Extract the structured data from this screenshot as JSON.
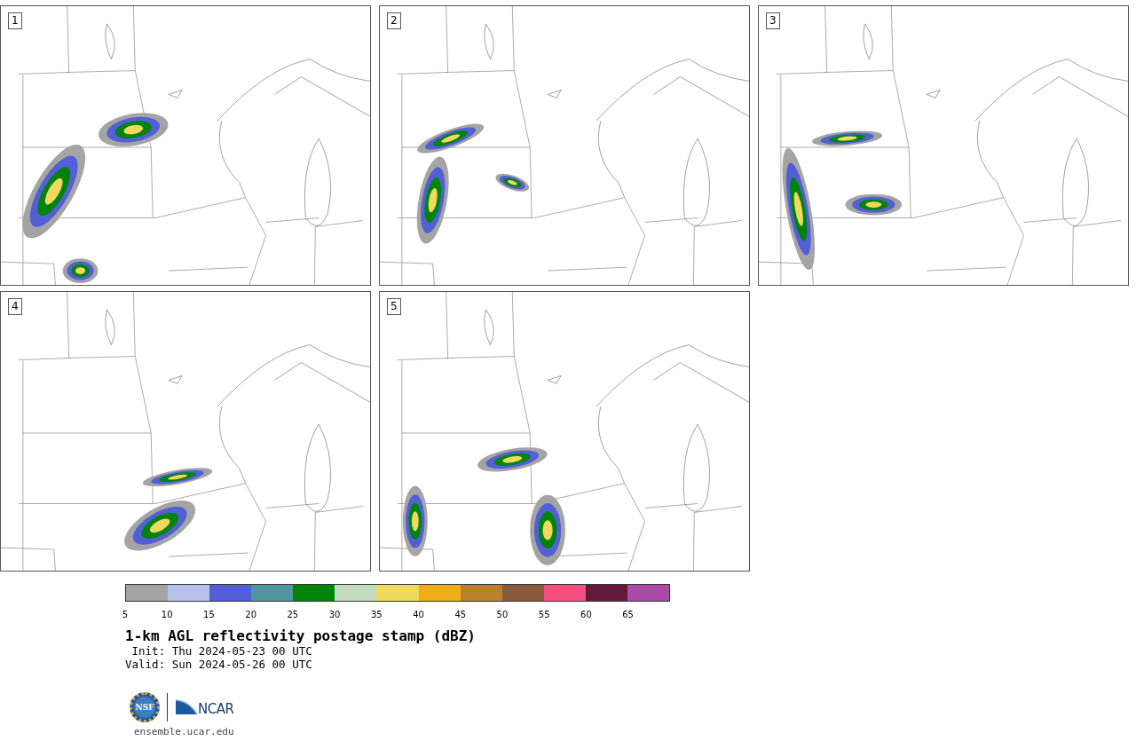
{
  "panels": [
    {
      "label": "1"
    },
    {
      "label": "2"
    },
    {
      "label": "3"
    },
    {
      "label": "4"
    },
    {
      "label": "5"
    }
  ],
  "colorbar": {
    "bins": [
      {
        "color": "#a4a4a4"
      },
      {
        "color": "#b8c2ec"
      },
      {
        "color": "#525fd6"
      },
      {
        "color": "#51969e"
      },
      {
        "color": "#02840a"
      },
      {
        "color": "#bfdcbe"
      },
      {
        "color": "#efd95e"
      },
      {
        "color": "#efae19"
      },
      {
        "color": "#b9812e"
      },
      {
        "color": "#8a5a3d"
      },
      {
        "color": "#f54f80"
      },
      {
        "color": "#621a38"
      },
      {
        "color": "#ab4ba6"
      }
    ],
    "ticks": [
      "5",
      "10",
      "15",
      "20",
      "25",
      "30",
      "35",
      "40",
      "45",
      "50",
      "55",
      "60",
      "65"
    ]
  },
  "title": "1-km AGL reflectivity postage stamp (dBZ)",
  "init": " Init: Thu 2024-05-23 00 UTC",
  "valid": "Valid: Sun 2024-05-26 00 UTC",
  "logos": {
    "nsf": "NSF",
    "ncar": "NCAR"
  },
  "link": "ensemble.ucar.edu"
}
